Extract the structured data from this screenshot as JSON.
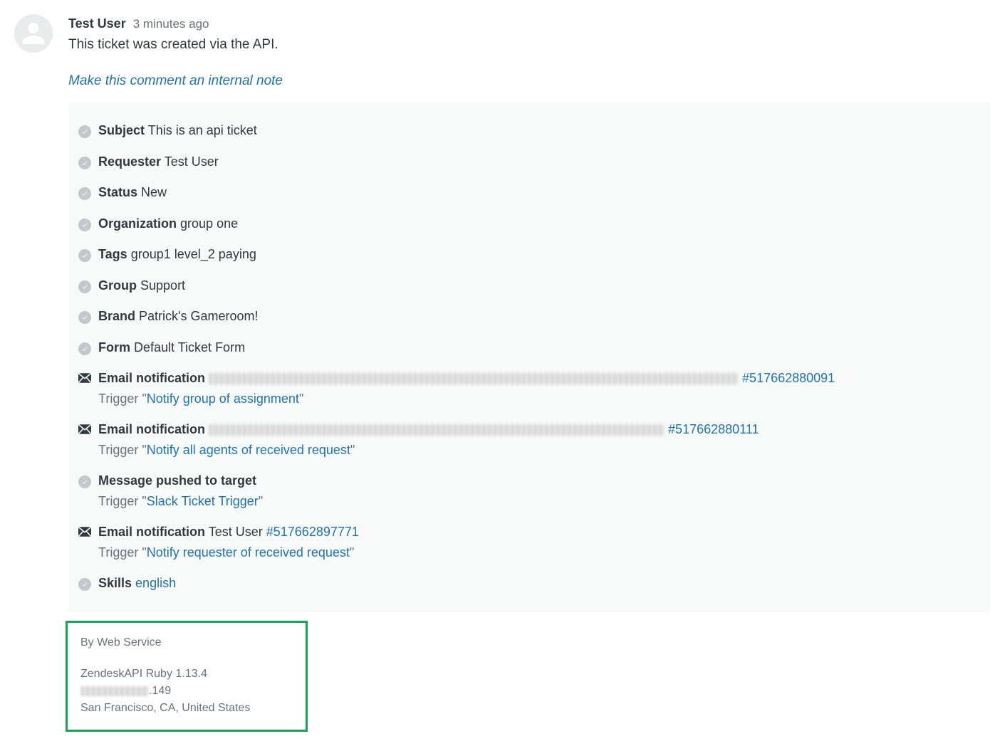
{
  "comment": {
    "user": "Test User",
    "timestamp": "3 minutes ago",
    "body": "This ticket was created via the API.",
    "internal_note_action": "Make this comment an internal note"
  },
  "events": [
    {
      "type": "check",
      "label": "Subject",
      "value": "This is an api ticket"
    },
    {
      "type": "check",
      "label": "Requester",
      "value": "Test User"
    },
    {
      "type": "check",
      "label": "Status",
      "value": "New"
    },
    {
      "type": "check",
      "label": "Organization",
      "value": "group one"
    },
    {
      "type": "check",
      "label": "Tags",
      "value": "group1 level_2 paying"
    },
    {
      "type": "check",
      "label": "Group",
      "value": "Support"
    },
    {
      "type": "check",
      "label": "Brand",
      "value": "Patrick's Gameroom!"
    },
    {
      "type": "check",
      "label": "Form",
      "value": "Default Ticket Form"
    },
    {
      "type": "mail",
      "label": "Email notification",
      "redact_width": 744,
      "link": "#517662880091",
      "trigger": "Notify group of assignment"
    },
    {
      "type": "mail",
      "label": "Email notification",
      "redact_width": 640,
      "link": "#517662880111",
      "trigger": "Notify all agents of received request"
    },
    {
      "type": "check",
      "label": "Message pushed to target",
      "trigger": "Slack Ticket Trigger"
    },
    {
      "type": "mail",
      "label": "Email notification",
      "value": "Test User",
      "link": "#517662897771",
      "trigger": "Notify requester of received request"
    },
    {
      "type": "check",
      "label": "Skills",
      "link_value": "english"
    }
  ],
  "meta": {
    "by": "By Web Service",
    "client": "ZendeskAPI Ruby 1.13.4",
    "ip_suffix": ".149",
    "location": "San Francisco, CA, United States"
  }
}
